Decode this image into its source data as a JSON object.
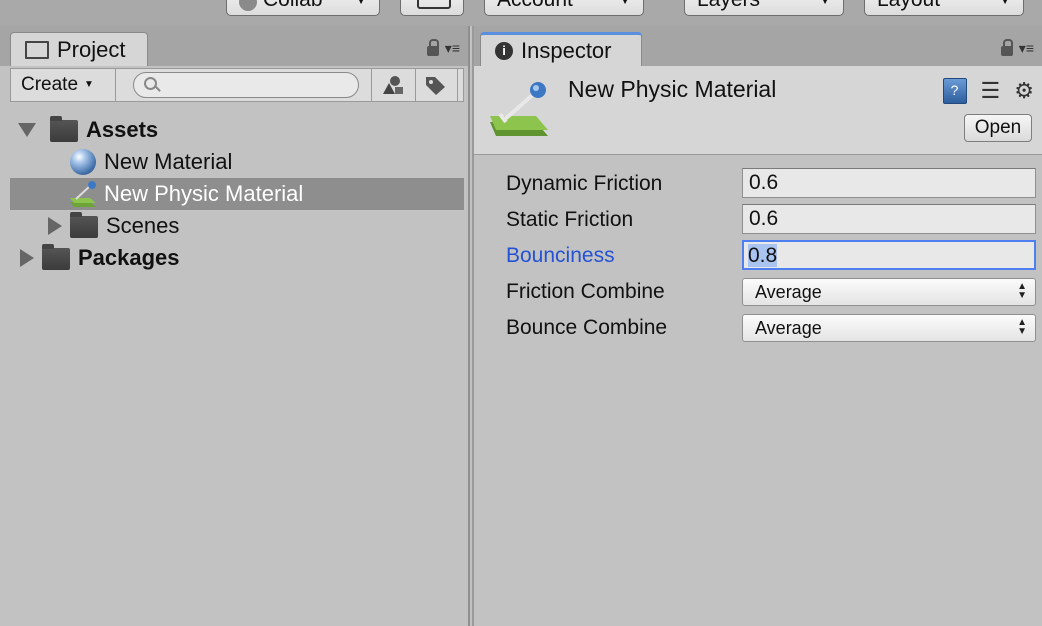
{
  "toolbar": {
    "collab_label": "Collab",
    "account_label": "Account",
    "layers_label": "Layers",
    "layout_label": "Layout"
  },
  "project": {
    "tab_label": "Project",
    "create_label": "Create",
    "search_placeholder": "",
    "tree": [
      {
        "label": "Assets",
        "icon": "folder-icon",
        "expanded": true
      },
      {
        "label": "New Material",
        "icon": "material-sphere-icon"
      },
      {
        "label": "New Physic Material",
        "icon": "physic-material-icon",
        "selected": true
      },
      {
        "label": "Scenes",
        "icon": "folder-icon",
        "expanded": false
      },
      {
        "label": "Packages",
        "icon": "folder-icon",
        "expanded": false
      }
    ]
  },
  "inspector": {
    "tab_label": "Inspector",
    "asset_title": "New Physic Material",
    "open_label": "Open",
    "properties": [
      {
        "label": "Dynamic Friction",
        "value": "0.6"
      },
      {
        "label": "Static Friction",
        "value": "0.6"
      },
      {
        "label": "Bounciness",
        "value": "0.8"
      },
      {
        "label": "Friction Combine",
        "value": "Average"
      },
      {
        "label": "Bounce Combine",
        "value": "Average"
      }
    ]
  },
  "colors": {
    "accent_blue": "#2352d6",
    "focus_border": "#4d7ff0",
    "selection_row": "#8e8e8e",
    "panel_bg": "#c2c2c2"
  }
}
